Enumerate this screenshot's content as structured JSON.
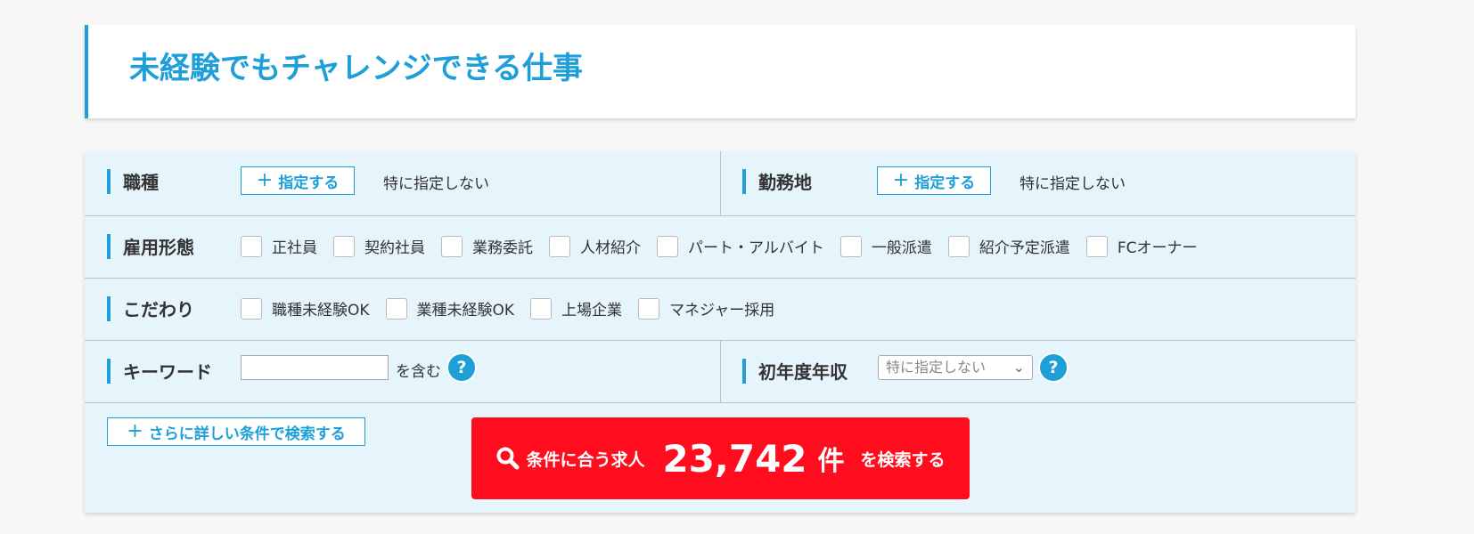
{
  "page": {
    "title": "未経験でもチャレンジできる仕事"
  },
  "colors": {
    "accent": "#1e9fd8",
    "panel_bg": "#e6f4fb",
    "search_button": "#ff0d1e"
  },
  "occupation": {
    "label": "職種",
    "specify_button": "指定する",
    "value": "特に指定しない"
  },
  "location": {
    "label": "勤務地",
    "specify_button": "指定する",
    "value": "特に指定しない"
  },
  "employment": {
    "label": "雇用形態",
    "options": [
      "正社員",
      "契約社員",
      "業務委託",
      "人材紹介",
      "パート・アルバイト",
      "一般派遣",
      "紹介予定派遣",
      "FCオーナー"
    ]
  },
  "preferences": {
    "label": "こだわり",
    "options": [
      "職種未経験OK",
      "業種未経験OK",
      "上場企業",
      "マネジャー採用"
    ]
  },
  "keyword": {
    "label": "キーワード",
    "value": "",
    "contains_text": "を含む",
    "help_icon": "?"
  },
  "salary": {
    "label": "初年度年収",
    "selected": "特に指定しない",
    "help_icon": "?"
  },
  "more_conditions_button": "さらに詳しい条件で検索する",
  "search_button": {
    "prefix": "条件に合う求人",
    "count": "23,742",
    "unit": "件",
    "suffix": "を検索する"
  }
}
